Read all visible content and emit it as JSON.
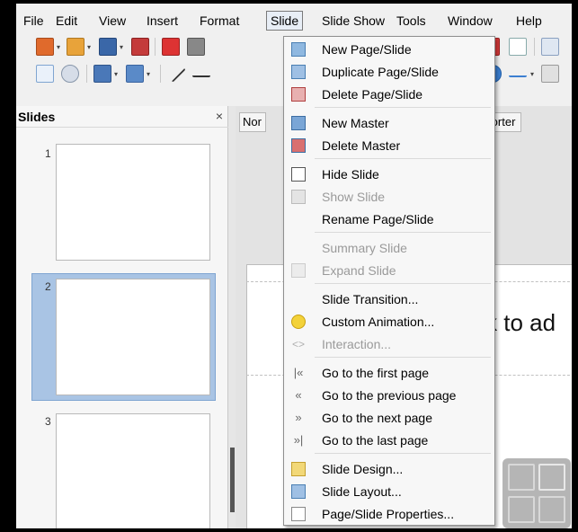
{
  "menubar": {
    "file": "File",
    "edit": "Edit",
    "view": "View",
    "insert": "Insert",
    "format": "Format",
    "slide": "Slide",
    "slide_show": "Slide Show",
    "tools": "Tools",
    "window": "Window",
    "help": "Help"
  },
  "slides_pane": {
    "title": "Slides",
    "close": "×",
    "slides": [
      "1",
      "2",
      "3"
    ],
    "selected_slide": "2"
  },
  "main": {
    "tab_normal": "Nor",
    "tab_sorter": "Sorter",
    "title_placeholder": "k to ad"
  },
  "slide_menu": {
    "items": [
      {
        "label": "New Page/Slide",
        "icon": "new-slide-icon",
        "enabled": true
      },
      {
        "label": "Duplicate Page/Slide",
        "icon": "duplicate-slide-icon",
        "enabled": true
      },
      {
        "label": "Delete Page/Slide",
        "icon": "delete-slide-icon",
        "enabled": true
      },
      {
        "label": "New Master",
        "icon": "new-master-icon",
        "enabled": true
      },
      {
        "label": "Delete Master",
        "icon": "delete-master-icon",
        "enabled": true
      },
      {
        "label": "Hide Slide",
        "icon": "hide-slide-icon",
        "enabled": true
      },
      {
        "label": "Show Slide",
        "icon": "show-slide-icon",
        "enabled": false
      },
      {
        "label": "Rename Page/Slide",
        "icon": "",
        "enabled": true
      },
      {
        "label": "Summary Slide",
        "icon": "",
        "enabled": false
      },
      {
        "label": "Expand Slide",
        "icon": "expand-slide-icon",
        "enabled": false
      },
      {
        "label": "Slide Transition...",
        "icon": "",
        "enabled": true
      },
      {
        "label": "Custom Animation...",
        "icon": "custom-animation-icon",
        "enabled": true
      },
      {
        "label": "Interaction...",
        "icon": "interaction-icon",
        "enabled": false
      },
      {
        "label": "Go to the first page",
        "icon": "first-page-icon",
        "enabled": true
      },
      {
        "label": "Go to the previous page",
        "icon": "previous-page-icon",
        "enabled": true
      },
      {
        "label": "Go to the next page",
        "icon": "next-page-icon",
        "enabled": true
      },
      {
        "label": "Go to the last page",
        "icon": "last-page-icon",
        "enabled": true
      },
      {
        "label": "Slide Design...",
        "icon": "slide-design-icon",
        "enabled": true
      },
      {
        "label": "Slide Layout...",
        "icon": "slide-layout-icon",
        "enabled": true
      },
      {
        "label": "Page/Slide Properties...",
        "icon": "slide-properties-icon",
        "enabled": true
      }
    ]
  },
  "colors": {
    "menu_bg": "#f7f7f7",
    "selection": "#a9c4e4",
    "disabled_text": "#9a9a9a"
  }
}
